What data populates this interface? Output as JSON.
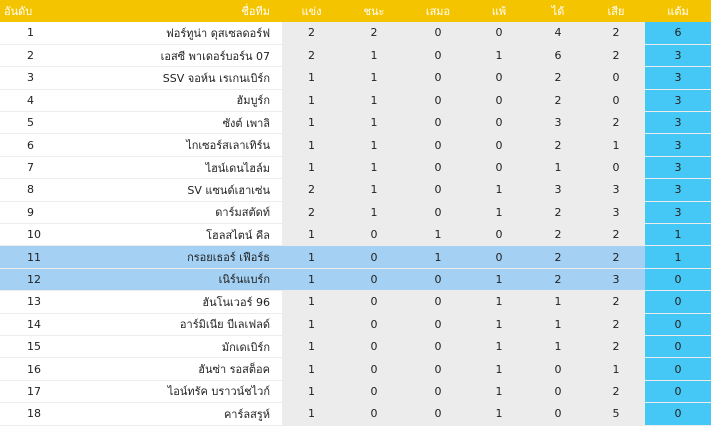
{
  "columns": {
    "rank": "อันดับ",
    "team": "ชื่อทีม",
    "played": "แข่ง",
    "won": "ชนะ",
    "drawn": "เสมอ",
    "lost": "แพ้",
    "goals_for": "ได้",
    "goals_against": "เสีย",
    "points": "แต้ม"
  },
  "colors": {
    "header": "#f5c400",
    "points": "#45c8f5",
    "highlight": "#a3d0f3",
    "stat_bg": "#ececec"
  },
  "highlighted_rows": [
    10,
    11
  ],
  "rows": [
    {
      "rank": "1",
      "team": "ฟอร์ทูน่า ดุสเซลดอร์ฟ",
      "played": "2",
      "won": "2",
      "drawn": "0",
      "lost": "0",
      "gf": "4",
      "ga": "2",
      "pts": "6"
    },
    {
      "rank": "2",
      "team": "เอสซี พาเดอร์บอร์น 07",
      "played": "2",
      "won": "1",
      "drawn": "0",
      "lost": "1",
      "gf": "6",
      "ga": "2",
      "pts": "3"
    },
    {
      "rank": "3",
      "team": "SSV จอห์น เรเกนเบิร์ก",
      "played": "1",
      "won": "1",
      "drawn": "0",
      "lost": "0",
      "gf": "2",
      "ga": "0",
      "pts": "3"
    },
    {
      "rank": "4",
      "team": "ฮัมบูร์ก",
      "played": "1",
      "won": "1",
      "drawn": "0",
      "lost": "0",
      "gf": "2",
      "ga": "0",
      "pts": "3"
    },
    {
      "rank": "5",
      "team": "ซังต์ เพาลิ",
      "played": "1",
      "won": "1",
      "drawn": "0",
      "lost": "0",
      "gf": "3",
      "ga": "2",
      "pts": "3"
    },
    {
      "rank": "6",
      "team": "ไกเซอร์สเลาเทิร์น",
      "played": "1",
      "won": "1",
      "drawn": "0",
      "lost": "0",
      "gf": "2",
      "ga": "1",
      "pts": "3"
    },
    {
      "rank": "7",
      "team": "ไฮน์เดนไฮล์ม",
      "played": "1",
      "won": "1",
      "drawn": "0",
      "lost": "0",
      "gf": "1",
      "ga": "0",
      "pts": "3"
    },
    {
      "rank": "8",
      "team": "SV แซนด์เฮาเซ่น",
      "played": "2",
      "won": "1",
      "drawn": "0",
      "lost": "1",
      "gf": "3",
      "ga": "3",
      "pts": "3"
    },
    {
      "rank": "9",
      "team": "ดาร์มสตัดท์",
      "played": "2",
      "won": "1",
      "drawn": "0",
      "lost": "1",
      "gf": "2",
      "ga": "3",
      "pts": "3"
    },
    {
      "rank": "10",
      "team": "โฮลสไตน์ คีล",
      "played": "1",
      "won": "0",
      "drawn": "1",
      "lost": "0",
      "gf": "2",
      "ga": "2",
      "pts": "1"
    },
    {
      "rank": "11",
      "team": "กรอยเธอร์ เฟือร์ธ",
      "played": "1",
      "won": "0",
      "drawn": "1",
      "lost": "0",
      "gf": "2",
      "ga": "2",
      "pts": "1"
    },
    {
      "rank": "12",
      "team": "เนิร์นแบร์ก",
      "played": "1",
      "won": "0",
      "drawn": "0",
      "lost": "1",
      "gf": "2",
      "ga": "3",
      "pts": "0"
    },
    {
      "rank": "13",
      "team": "ฮันโนเวอร์ 96",
      "played": "1",
      "won": "0",
      "drawn": "0",
      "lost": "1",
      "gf": "1",
      "ga": "2",
      "pts": "0"
    },
    {
      "rank": "14",
      "team": "อาร์มิเนีย บีเลเฟลด์",
      "played": "1",
      "won": "0",
      "drawn": "0",
      "lost": "1",
      "gf": "1",
      "ga": "2",
      "pts": "0"
    },
    {
      "rank": "15",
      "team": "มักเดเบิร์ก",
      "played": "1",
      "won": "0",
      "drawn": "0",
      "lost": "1",
      "gf": "1",
      "ga": "2",
      "pts": "0"
    },
    {
      "rank": "16",
      "team": "ฮันซ่า รอสต็อค",
      "played": "1",
      "won": "0",
      "drawn": "0",
      "lost": "1",
      "gf": "0",
      "ga": "1",
      "pts": "0"
    },
    {
      "rank": "17",
      "team": "ไอน์ทรัค บราวน์ชไวก์",
      "played": "1",
      "won": "0",
      "drawn": "0",
      "lost": "1",
      "gf": "0",
      "ga": "2",
      "pts": "0"
    },
    {
      "rank": "18",
      "team": "คาร์ลสรูห์",
      "played": "1",
      "won": "0",
      "drawn": "0",
      "lost": "1",
      "gf": "0",
      "ga": "5",
      "pts": "0"
    }
  ]
}
